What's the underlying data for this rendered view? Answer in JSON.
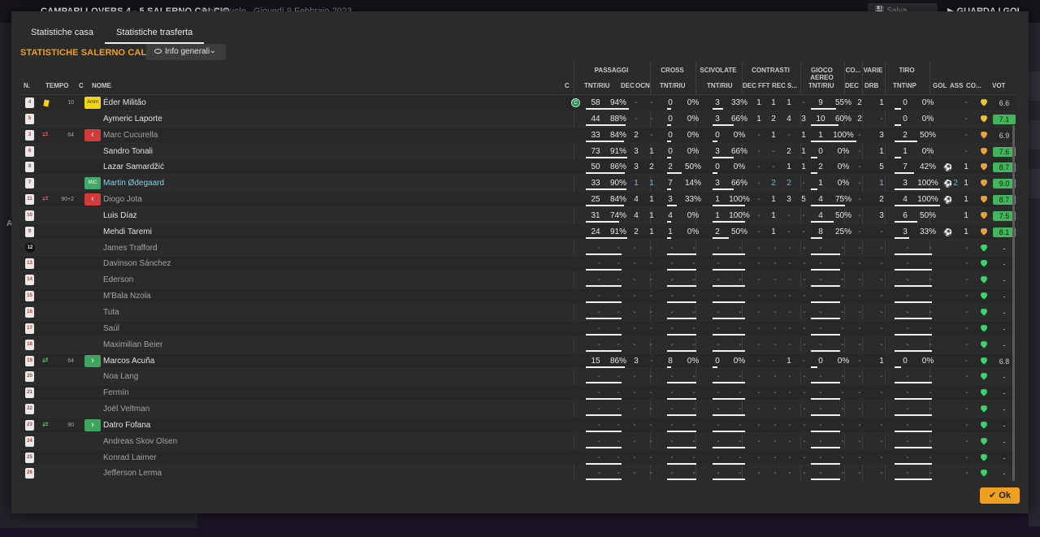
{
  "background": {
    "back_icon": "←",
    "match_score": "CAMPARI LOVERS  4 - 5  SALERNO CALCIO",
    "match_type": "Amichevole",
    "match_date": "Giovedì 9 Febbraio 2023",
    "save_label": "Salva partita",
    "watch_label": "GUARDA I GOL",
    "left_stray": "A"
  },
  "tabs": [
    "Statistiche casa",
    "Statistiche trasferta"
  ],
  "active_tab": 1,
  "title": "STATISTICHE SALERNO CALCIO",
  "view_dropdown": "Info generali",
  "groups": [
    "PASSAGGI",
    "CROSS",
    "SCIVOLATE",
    "CONTRASTI",
    "GIOCO AEREO",
    "CO...",
    "VARIE",
    "TIRO"
  ],
  "headers": [
    "N.",
    "TEMPO",
    "C",
    "NOME",
    "C",
    "TNT/RIU",
    "DEC",
    "OCN",
    "TNT/RIU",
    "TNT/RIU",
    "DEC",
    "FFT",
    "REC",
    "S...",
    "TNT/RIU",
    "DEC",
    "DRB",
    "TNT\\NP",
    "GOL",
    "ASS",
    "CO...",
    "VOT"
  ],
  "ok_label": "Ok",
  "icons": {
    "yellow_card": "yellow-card-icon",
    "sub_in": "sub-in-icon",
    "sub_out": "sub-out-icon",
    "goal": "ball-icon",
    "morale": "heart-icon",
    "captain": "captain-icon"
  },
  "players": [
    {
      "num": "4",
      "min": "10",
      "card": "yellow",
      "badge": "Amm",
      "name": "Éder Militão",
      "cap": "C",
      "pt": "58",
      "pp": "94%",
      "pdec": "-",
      "pocn": "-",
      "ct": "0",
      "cp": "0%",
      "st": "3",
      "sp": "33%",
      "cdec": "1",
      "cfft": "1",
      "crec": "1",
      "cs": "-",
      "at": "9",
      "ap": "55%",
      "codec": "2",
      "drb": "1",
      "tt": "0",
      "tp": "0%",
      "gol": "",
      "ass": "-",
      "mor": "yellow",
      "vot": "6.6",
      "rclass": "plain"
    },
    {
      "num": "5",
      "min": "",
      "name": "Aymeric Laporte",
      "pt": "44",
      "pp": "88%",
      "pdec": "-",
      "pocn": "-",
      "ct": "0",
      "cp": "0%",
      "st": "3",
      "sp": "66%",
      "cdec": "1",
      "cfft": "2",
      "crec": "4",
      "cs": "3",
      "at": "10",
      "ap": "60%",
      "codec": "2",
      "drb": "-",
      "tt": "0",
      "tp": "0%",
      "gol": "",
      "ass": "-",
      "mor": "yellow",
      "vot": "7.1",
      "rclass": "gbg"
    },
    {
      "num": "3",
      "min": "64",
      "sub": "out",
      "badge": "‹",
      "name": "Marc Cucurella",
      "dim": true,
      "pt": "33",
      "pp": "84%",
      "pdec": "2",
      "pocn": "-",
      "ct": "0",
      "cp": "0%",
      "st": "0",
      "sp": "0%",
      "cdec": "-",
      "cfft": "1",
      "crec": "-",
      "cs": "1",
      "at": "1",
      "ap": "100%",
      "codec": "-",
      "drb": "3",
      "tt": "2",
      "tp": "50%",
      "gol": "",
      "ass": "-",
      "mor": "orange",
      "vot": "6.9",
      "rclass": "plain"
    },
    {
      "num": "6",
      "min": "",
      "name": "Sandro Tonali",
      "pt": "73",
      "pp": "91%",
      "pdec": "3",
      "pocn": "1",
      "ct": "0",
      "cp": "0%",
      "st": "3",
      "sp": "66%",
      "cdec": "-",
      "cfft": "-",
      "crec": "2",
      "cs": "1",
      "at": "0",
      "ap": "0%",
      "codec": "-",
      "drb": "1",
      "tt": "1",
      "tp": "0%",
      "gol": "",
      "ass": "-",
      "mor": "orange",
      "vot": "7.6",
      "rclass": "gbg"
    },
    {
      "num": "8",
      "min": "",
      "name": "Lazar Samardžić",
      "pt": "50",
      "pp": "86%",
      "pdec": "3",
      "pocn": "2",
      "ct": "2",
      "cp": "50%",
      "st": "0",
      "sp": "0%",
      "cdec": "-",
      "cfft": "-",
      "crec": "1",
      "cs": "1",
      "at": "2",
      "ap": "0%",
      "codec": "-",
      "drb": "5",
      "tt": "7",
      "tp": "42%",
      "gol": "1",
      "ass": "1",
      "mor": "orange",
      "vot": "8.7",
      "rclass": "gbg"
    },
    {
      "num": "7",
      "min": "",
      "badge": "MiC",
      "name": "Martin Ødegaard",
      "link": true,
      "pt": "33",
      "pp": "90%",
      "pdec": "1",
      "pocn": "1",
      "ct": "7",
      "cp": "14%",
      "st": "3",
      "sp": "66%",
      "cdec": "-",
      "cfft": "2",
      "crec": "2",
      "cs": "-",
      "at": "1",
      "ap": "0%",
      "codec": "-",
      "drb": "1",
      "tt": "3",
      "tp": "100%",
      "gol": "2",
      "ass": "1",
      "mor": "orange",
      "vot": "9.0",
      "rclass": "gbg",
      "cyan": true
    },
    {
      "num": "11",
      "min": "90+2",
      "sub": "out",
      "badge": "‹",
      "name": "Diogo Jota",
      "dim": true,
      "pt": "25",
      "pp": "84%",
      "pdec": "4",
      "pocn": "1",
      "ct": "3",
      "cp": "33%",
      "st": "1",
      "sp": "100%",
      "cdec": "-",
      "cfft": "1",
      "crec": "3",
      "cs": "5",
      "at": "4",
      "ap": "75%",
      "codec": "-",
      "drb": "2",
      "tt": "4",
      "tp": "100%",
      "gol": "1",
      "ass": "1",
      "mor": "orange",
      "vot": "8.7",
      "rclass": "gbg"
    },
    {
      "num": "10",
      "min": "",
      "name": "Luis Díaz",
      "pt": "31",
      "pp": "74%",
      "pdec": "4",
      "pocn": "1",
      "ct": "4",
      "cp": "0%",
      "st": "1",
      "sp": "100%",
      "cdec": "-",
      "cfft": "1",
      "crec": "-",
      "cs": "-",
      "at": "4",
      "ap": "50%",
      "codec": "-",
      "drb": "3",
      "tt": "6",
      "tp": "50%",
      "gol": "",
      "ass": "1",
      "mor": "orange",
      "vot": "7.5",
      "rclass": "gbg"
    },
    {
      "num": "9",
      "min": "",
      "name": "Mehdi Taremi",
      "pt": "24",
      "pp": "91%",
      "pdec": "2",
      "pocn": "1",
      "ct": "1",
      "cp": "0%",
      "st": "2",
      "sp": "50%",
      "cdec": "-",
      "cfft": "1",
      "crec": "-",
      "cs": "-",
      "at": "8",
      "ap": "25%",
      "codec": "-",
      "drb": "-",
      "tt": "3",
      "tp": "33%",
      "gol": "1",
      "ass": "1",
      "mor": "orange",
      "vot": "8.1",
      "rclass": "gbg"
    },
    {
      "num": "12",
      "gk": true,
      "name": "James Trafford",
      "dim": true,
      "empty": true,
      "mor": "green",
      "vot": "-"
    },
    {
      "num": "13",
      "name": "Davinson Sánchez",
      "dim": true,
      "empty": true,
      "mor": "green",
      "vot": "-"
    },
    {
      "num": "14",
      "name": "Ederson",
      "dim": true,
      "empty": true,
      "mor": "green",
      "vot": "-"
    },
    {
      "num": "15",
      "name": "M'Bala Nzola",
      "dim": true,
      "empty": true,
      "mor": "green",
      "vot": "-"
    },
    {
      "num": "16",
      "name": "Tuta",
      "dim": true,
      "empty": true,
      "mor": "green",
      "vot": "-"
    },
    {
      "num": "17",
      "name": "Saúl",
      "dim": true,
      "empty": true,
      "mor": "green",
      "vot": "-"
    },
    {
      "num": "18",
      "name": "Maximilian Beier",
      "dim": true,
      "empty": true,
      "mor": "green",
      "vot": "-"
    },
    {
      "num": "19",
      "min": "64",
      "sub": "in",
      "badge": "›",
      "name": "Marcos Acuña",
      "pt": "15",
      "pp": "86%",
      "pdec": "3",
      "pocn": "-",
      "ct": "8",
      "cp": "0%",
      "st": "0",
      "sp": "0%",
      "cdec": "-",
      "cfft": "-",
      "crec": "1",
      "cs": "-",
      "at": "0",
      "ap": "0%",
      "codec": "-",
      "drb": "1",
      "tt": "0",
      "tp": "0%",
      "gol": "",
      "ass": "-",
      "mor": "green",
      "vot": "6.8",
      "rclass": "plain"
    },
    {
      "num": "20",
      "name": "Noa Lang",
      "dim": true,
      "empty": true,
      "mor": "green",
      "vot": "-"
    },
    {
      "num": "21",
      "name": "Fermín",
      "dim": true,
      "empty": true,
      "mor": "green",
      "vot": "-"
    },
    {
      "num": "22",
      "name": "Joël Veltman",
      "dim": true,
      "empty": true,
      "mor": "green",
      "vot": "-"
    },
    {
      "num": "23",
      "min": "90",
      "sub": "in",
      "badge": "›",
      "name": "Datro Fofana",
      "empty": true,
      "mor": "green",
      "vot": "-"
    },
    {
      "num": "24",
      "name": "Andreas Skov Olsen",
      "dim": true,
      "empty": true,
      "mor": "green",
      "vot": "-"
    },
    {
      "num": "25",
      "name": "Konrad Laimer",
      "dim": true,
      "empty": true,
      "mor": "green",
      "vot": "-"
    },
    {
      "num": "26",
      "name": "Jefferson Lerma",
      "dim": true,
      "empty": true,
      "mor": "green",
      "vot": "-"
    }
  ]
}
